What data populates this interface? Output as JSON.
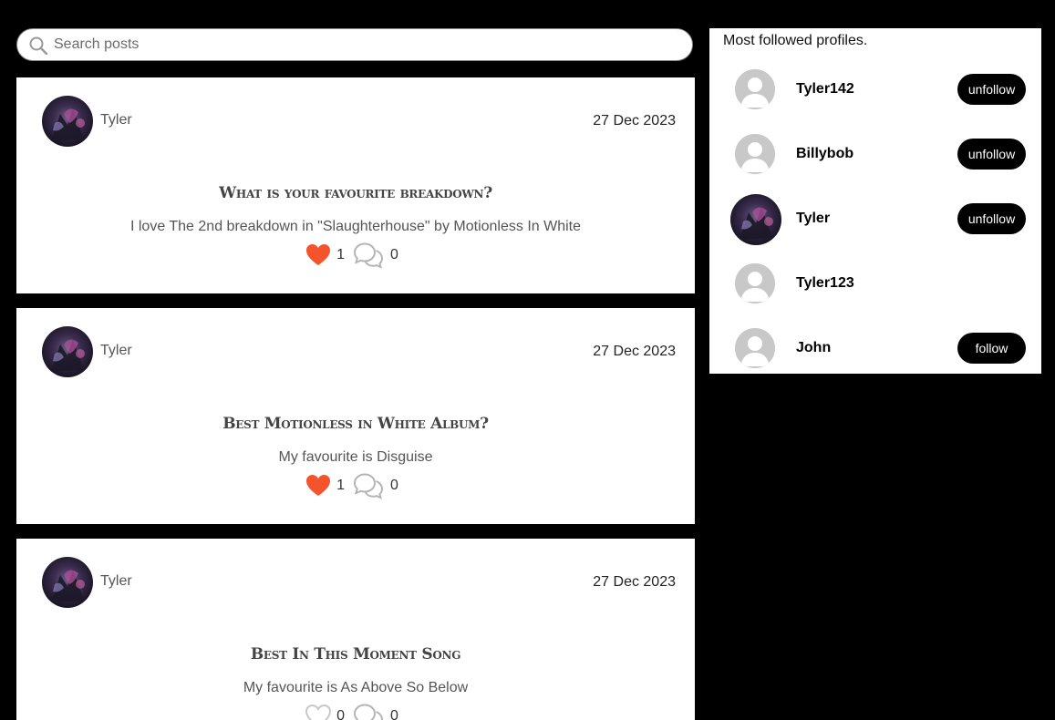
{
  "search": {
    "placeholder": "Search posts"
  },
  "posts": [
    {
      "author": "Tyler",
      "date": "27 Dec 2023",
      "title": "What is your favourite breakdown?",
      "body": "I love The 2nd breakdown in \"Slaughterhouse\" by Motionless In White",
      "likes": "1",
      "comments": "0",
      "liked": true
    },
    {
      "author": "Tyler",
      "date": "27 Dec 2023",
      "title": "Best Motionless in White Album?",
      "body": "My favourite is Disguise",
      "likes": "1",
      "comments": "0",
      "liked": true
    },
    {
      "author": "Tyler",
      "date": "27 Dec 2023",
      "title": "Best In This Moment Song",
      "body": "My favourite is As Above So Below",
      "likes": "0",
      "comments": "0",
      "liked": false
    }
  ],
  "sidebar": {
    "title": "Most followed profiles.",
    "profiles": [
      {
        "name": "Tyler142",
        "button": "unfollow",
        "avatar": "default"
      },
      {
        "name": "Billybob",
        "button": "unfollow",
        "avatar": "default"
      },
      {
        "name": "Tyler",
        "button": "unfollow",
        "avatar": "photo"
      },
      {
        "name": "Tyler123",
        "button": "",
        "avatar": "default"
      },
      {
        "name": "John",
        "button": "follow",
        "avatar": "default"
      }
    ]
  },
  "colors": {
    "heart_liked": "#f4532c",
    "heart_outline": "#c8c8c8",
    "button_bg": "#000000",
    "default_avatar": "#c8c8c8"
  }
}
